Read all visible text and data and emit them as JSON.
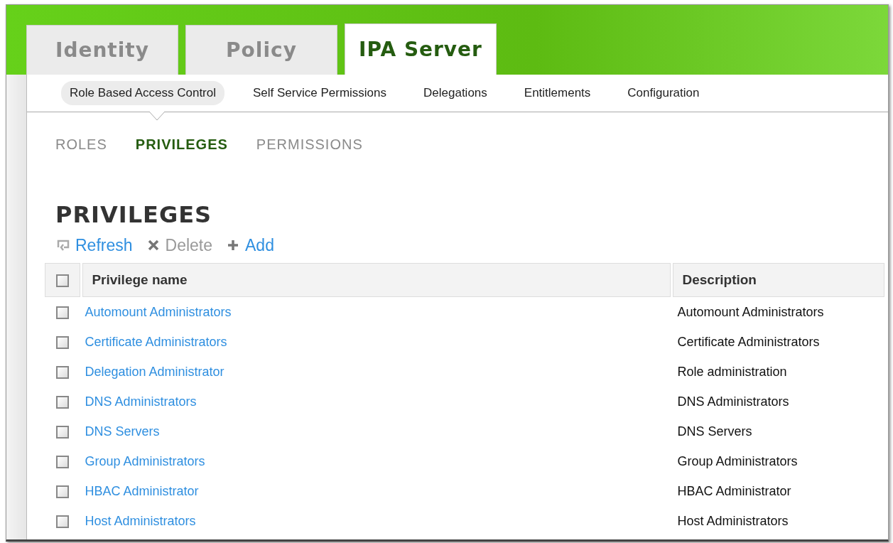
{
  "tabs": [
    {
      "label": "Identity",
      "selected": false
    },
    {
      "label": "Policy",
      "selected": false
    },
    {
      "label": "IPA Server",
      "selected": true
    }
  ],
  "subnav": [
    {
      "label": "Role Based Access Control",
      "selected": true
    },
    {
      "label": "Self Service Permissions",
      "selected": false
    },
    {
      "label": "Delegations",
      "selected": false
    },
    {
      "label": "Entitlements",
      "selected": false
    },
    {
      "label": "Configuration",
      "selected": false
    }
  ],
  "facets": [
    {
      "label": "ROLES",
      "selected": false
    },
    {
      "label": "PRIVILEGES",
      "selected": true
    },
    {
      "label": "PERMISSIONS",
      "selected": false
    }
  ],
  "heading": "PRIVILEGES",
  "actions": [
    {
      "kind": "refresh",
      "label": "Refresh",
      "disabled": false
    },
    {
      "kind": "delete",
      "label": "Delete",
      "disabled": true
    },
    {
      "kind": "add",
      "label": "Add",
      "disabled": false
    }
  ],
  "table": {
    "select_all": {
      "checked": false
    },
    "columns": [
      "Privilege name",
      "Description"
    ],
    "rows": [
      {
        "checked": false,
        "name": "Automount Administrators",
        "description": "Automount Administrators"
      },
      {
        "checked": false,
        "name": "Certificate Administrators",
        "description": "Certificate Administrators"
      },
      {
        "checked": false,
        "name": "Delegation Administrator",
        "description": "Role administration"
      },
      {
        "checked": false,
        "name": "DNS Administrators",
        "description": "DNS Administrators"
      },
      {
        "checked": false,
        "name": "DNS Servers",
        "description": "DNS Servers"
      },
      {
        "checked": false,
        "name": "Group Administrators",
        "description": "Group Administrators"
      },
      {
        "checked": false,
        "name": "HBAC Administrator",
        "description": "HBAC Administrator"
      },
      {
        "checked": false,
        "name": "Host Administrators",
        "description": "Host Administrators"
      }
    ]
  }
}
